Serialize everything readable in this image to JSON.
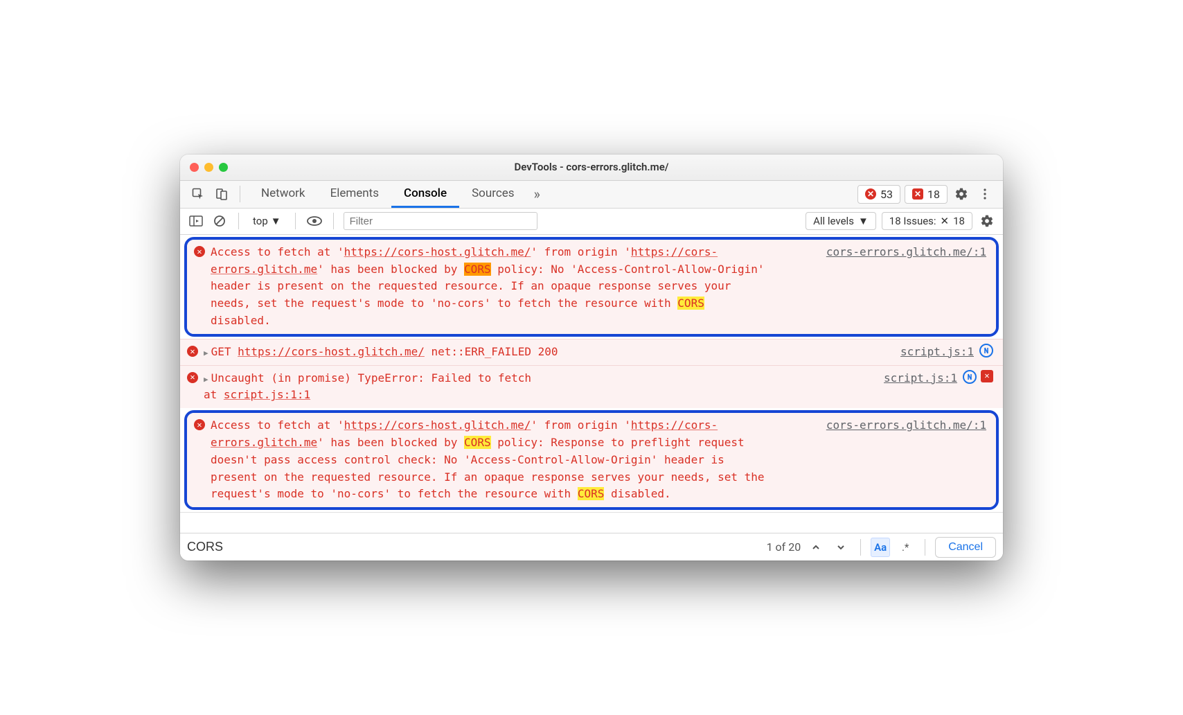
{
  "window": {
    "title": "DevTools - cors-errors.glitch.me/"
  },
  "tabs": {
    "items": [
      "Network",
      "Elements",
      "Console",
      "Sources"
    ],
    "active": "Console",
    "error_count": "53",
    "issue_count": "18"
  },
  "console_toolbar": {
    "context": "top",
    "filter_placeholder": "Filter",
    "levels": "All levels",
    "issues_label": "18 Issues:",
    "issues_count": "18"
  },
  "messages": [
    {
      "highlighted": true,
      "src": "cors-errors.glitch.me/:1",
      "parts": [
        {
          "t": "Access to fetch at '"
        },
        {
          "t": "https://cors-host.glitch.me/",
          "u": true
        },
        {
          "t": "' from origin '"
        },
        {
          "t": "https://cors-errors.glitch.me",
          "u": true
        },
        {
          "t": "' has been blocked by "
        },
        {
          "t": "CORS",
          "hl": "active"
        },
        {
          "t": " policy: No 'Access-Control-Allow-Origin' header is present on the requested resource. If an opaque response serves your needs, set the request's mode to 'no-cors' to fetch the resource with "
        },
        {
          "t": "CORS",
          "hl": "on"
        },
        {
          "t": " disabled."
        }
      ]
    },
    {
      "highlighted": false,
      "src": "script.js:1",
      "src_icons": [
        "circle"
      ],
      "disclosure": true,
      "parts": [
        {
          "t": "GET "
        },
        {
          "t": "https://cors-host.glitch.me/",
          "u": true
        },
        {
          "t": " net::ERR_FAILED 200"
        }
      ]
    },
    {
      "highlighted": false,
      "src": "script.js:1",
      "src_icons": [
        "circle",
        "square"
      ],
      "disclosure": true,
      "parts": [
        {
          "t": "Uncaught (in promise) TypeError: Failed to fetch"
        }
      ],
      "sub": [
        {
          "t": "    at "
        },
        {
          "t": "script.js:1:1",
          "u": true
        }
      ]
    },
    {
      "highlighted": true,
      "src": "cors-errors.glitch.me/:1",
      "parts": [
        {
          "t": "Access to fetch at '"
        },
        {
          "t": "https://cors-host.glitch.me/",
          "u": true
        },
        {
          "t": "' from origin '"
        },
        {
          "t": "https://cors-errors.glitch.me",
          "u": true
        },
        {
          "t": "' has been blocked by "
        },
        {
          "t": "CORS",
          "hl": "on"
        },
        {
          "t": " policy: Response to preflight request doesn't pass access control check: No 'Access-Control-Allow-Origin' header is present on the requested resource. If an opaque response serves your needs, set the request's mode to 'no-cors' to fetch the resource with "
        },
        {
          "t": "CORS",
          "hl": "on"
        },
        {
          "t": " disabled."
        }
      ]
    }
  ],
  "search": {
    "query": "CORS",
    "count": "1 of 20",
    "match_case_on": true,
    "regex_on": false,
    "cancel": "Cancel"
  }
}
